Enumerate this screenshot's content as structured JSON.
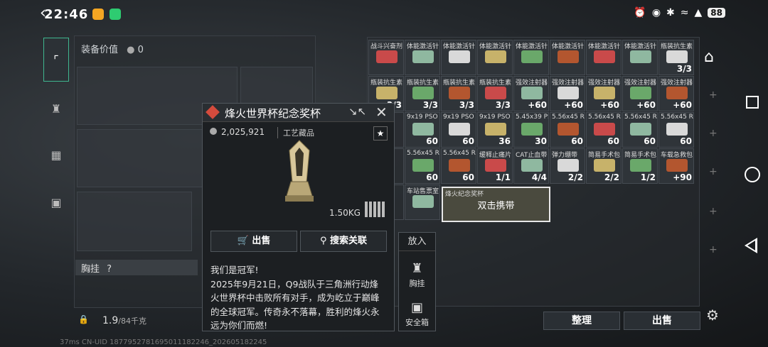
{
  "status_bar": {
    "time": "22:46",
    "battery": "88"
  },
  "equipment": {
    "value_label": "装备价值",
    "value": "0",
    "chest_label": "胸挂",
    "chest_help": "?",
    "weight_value": "1.9",
    "weight_limit": "/84千克"
  },
  "footer": {
    "text": "37ms   CN-UID 1877952781695011182246_202605182245"
  },
  "grid_cells": [
    {
      "name": "战斗兴奋剂",
      "count": ""
    },
    {
      "name": "体能激活针",
      "count": ""
    },
    {
      "name": "体能激活针",
      "count": ""
    },
    {
      "name": "体能激活针",
      "count": ""
    },
    {
      "name": "体能激活针",
      "count": ""
    },
    {
      "name": "体能激活针",
      "count": ""
    },
    {
      "name": "体能激活针",
      "count": ""
    },
    {
      "name": "体能激活针",
      "count": ""
    },
    {
      "name": "瓶装抗生素",
      "count": "3/3"
    },
    {
      "name": "瓶装抗生素",
      "count": "3/3"
    },
    {
      "name": "瓶装抗生素",
      "count": "3/3"
    },
    {
      "name": "瓶装抗生素",
      "count": "3/3"
    },
    {
      "name": "瓶装抗生素",
      "count": "3/3"
    },
    {
      "name": "强效注射器",
      "count": "+60"
    },
    {
      "name": "强效注射器",
      "count": "+60"
    },
    {
      "name": "强效注射器",
      "count": "+60"
    },
    {
      "name": "强效注射器",
      "count": "+60"
    },
    {
      "name": "强效注射器",
      "count": "+60"
    },
    {
      "name": "",
      "count": ""
    },
    {
      "name": "9x19 PSO",
      "count": "60"
    },
    {
      "name": "9x19 PSO",
      "count": "60"
    },
    {
      "name": "9x19 PSO",
      "count": "36"
    },
    {
      "name": "5.45x39 PS",
      "count": "30"
    },
    {
      "name": "5.56x45 RFIP",
      "count": "60"
    },
    {
      "name": "5.56x45 RFIP",
      "count": "60"
    },
    {
      "name": "5.56x45 RFIP",
      "count": "60"
    },
    {
      "name": "5.56x45 RFIP",
      "count": "60"
    },
    {
      "name": "",
      "count": ""
    },
    {
      "name": "5.56x45 RFIP",
      "count": "60"
    },
    {
      "name": "5.56x45 RFIP",
      "count": "60"
    },
    {
      "name": "缓释止痛片",
      "count": "1/1"
    },
    {
      "name": "CAT止血带",
      "count": "4/4"
    },
    {
      "name": "弹力绷带",
      "count": "2/2"
    },
    {
      "name": "简易手术包",
      "count": "2/2"
    },
    {
      "name": "简易手术包",
      "count": "1/2"
    },
    {
      "name": "车载急救包",
      "count": "+90"
    },
    {
      "name": "",
      "count": ""
    },
    {
      "name": "车站售票室",
      "count": ""
    }
  ],
  "big_item": {
    "tag": "烽火纪念奖杯",
    "action": "双击携带"
  },
  "bottom_buttons": {
    "organize": "整理",
    "sell": "出售"
  },
  "popup": {
    "title": "烽火世界杯纪念奖杯",
    "price": "2,025,921",
    "category": "工艺藏品",
    "weight": "1.50KG",
    "sell_label": "出售",
    "search_label": "搜索关联",
    "description": [
      "我们是冠军!",
      "2025年9月21日，Q9战队于三角洲行动烽",
      "火世界杯中击败所有对手，成为屹立于巅峰",
      "的全球冠军。传奇永不落幕，胜利的烽火永",
      "远为你们而燃!"
    ]
  },
  "put_in": {
    "header": "放入",
    "option1": "胸挂",
    "option2": "安全箱"
  },
  "colors": {
    "accent": "#3fb68f",
    "title_diamond": "#d44b3d"
  }
}
